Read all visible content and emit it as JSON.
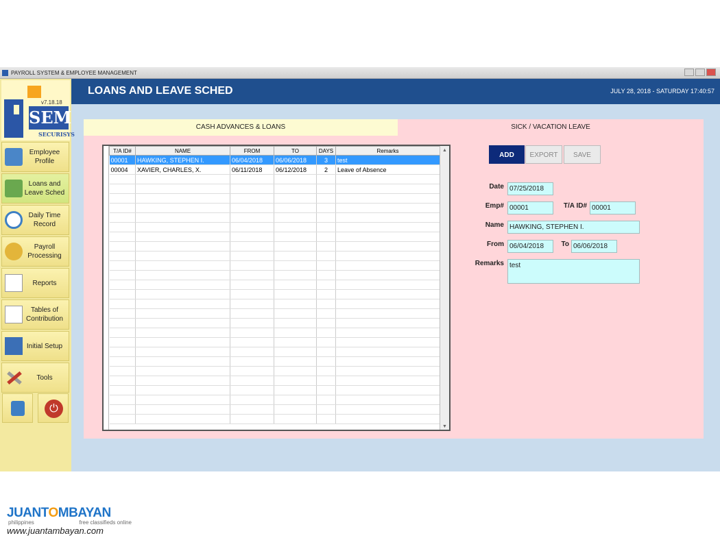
{
  "window": {
    "title": "PAYROLL SYSTEM & EMPLOYEE MANAGEMENT"
  },
  "logo": {
    "version": "v7.18.18",
    "brand": "SEM",
    "tagline": "SECURISYS"
  },
  "sidebar": {
    "items": [
      {
        "label": "Employee Profile",
        "icon": "employee-icon"
      },
      {
        "label": "Loans and Leave Sched",
        "icon": "loans-icon"
      },
      {
        "label": "Daily Time Record",
        "icon": "clock-icon"
      },
      {
        "label": "Payroll Processing",
        "icon": "payroll-icon"
      },
      {
        "label": "Reports",
        "icon": "reports-icon"
      },
      {
        "label": "Tables of Contribution",
        "icon": "tables-icon"
      },
      {
        "label": "Initial Setup",
        "icon": "building-icon"
      },
      {
        "label": "Tools",
        "icon": "tools-icon"
      }
    ]
  },
  "header": {
    "title": "LOANS AND LEAVE SCHED",
    "datetime": "JULY 28, 2018 - SATURDAY 17:40:57"
  },
  "tabs": {
    "left": "CASH ADVANCES & LOANS",
    "right": "SICK / VACATION LEAVE"
  },
  "grid": {
    "columns": [
      "T/A ID#",
      "NAME",
      "FROM",
      "TO",
      "DAYS",
      "Remarks"
    ],
    "rows": [
      {
        "ta": "00001",
        "name": "HAWKING, STEPHEN I.",
        "from": "06/04/2018",
        "to": "06/06/2018",
        "days": "3",
        "remarks": "test",
        "selected": true
      },
      {
        "ta": "00004",
        "name": "XAVIER, CHARLES, X.",
        "from": "06/11/2018",
        "to": "06/12/2018",
        "days": "2",
        "remarks": "Leave of Absence",
        "selected": false
      }
    ]
  },
  "actions": {
    "add": "ADD",
    "export": "EXPORT",
    "save": "SAVE"
  },
  "form": {
    "date_label": "Date",
    "date": "07/25/2018",
    "emp_label": "Emp#",
    "emp": "00001",
    "ta_label": "T/A ID#",
    "ta": "00001",
    "name_label": "Name",
    "name": "HAWKING, STEPHEN I.",
    "from_label": "From",
    "from": "06/04/2018",
    "to_label": "To",
    "to": "06/06/2018",
    "remarks_label": "Remarks",
    "remarks": "test"
  },
  "watermark": {
    "brand_a": "JUANT",
    "brand_o": "O",
    "brand_b": "MBAYAN",
    "sub_left": "philippines",
    "sub_right": "free classifieds online",
    "url": "www.juantambayan.com"
  }
}
